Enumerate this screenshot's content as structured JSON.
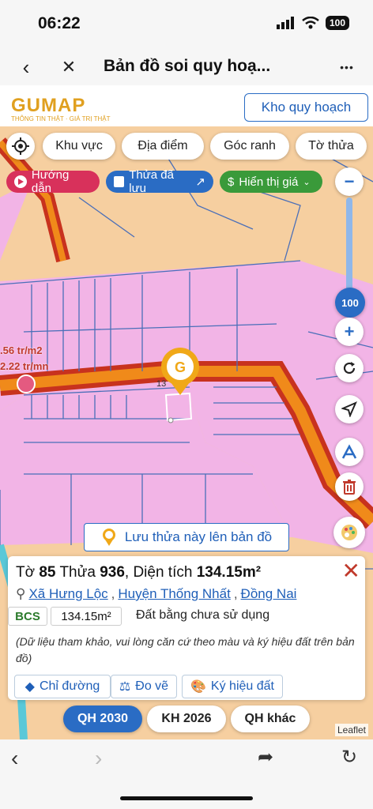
{
  "status": {
    "time": "06:22",
    "battery": "100"
  },
  "nav": {
    "title": "Bản đồ soi quy hoạ...",
    "back": "‹",
    "close": "✕",
    "more": "•••"
  },
  "header": {
    "logo": "GUMAP",
    "tagline": "THÔNG TIN THẬT · GIÁ TRỊ THẬT",
    "kho_label": "Kho quy hoạch"
  },
  "filters": {
    "khu_vuc": "Khu vực",
    "dia_diem": "Địa điểm",
    "goc_ranh": "Góc ranh",
    "to_thua": "Tờ thửa"
  },
  "pills": {
    "huong_dan": "Hướng dẫn",
    "thua_da_luu": "Thửa đã lưu",
    "hien_thi_gia": "Hiển thị giá"
  },
  "zoom": {
    "level": "100",
    "minus": "−",
    "plus": "+"
  },
  "map_labels": {
    "price1": ".56 tr/m2",
    "price2": "2.22 tr/mn",
    "parcel_no": "13"
  },
  "save_parcel": "Lưu thửa này lên bản đồ",
  "card": {
    "to_label": "Tờ",
    "to_value": "85",
    "thua_label": "Thửa",
    "thua_value": "936",
    "area_label": "Diện tích",
    "area_value": "134.15m²",
    "xa": "Xã Hưng Lộc",
    "huyen": "Huyện Thống Nhất",
    "tinh": "Đồng Nai",
    "land_code": "BCS",
    "land_area": "134.15m²",
    "land_type": "Đất bằng chưa sử dụng",
    "note": "(Dữ liệu tham khảo, vui lòng căn cứ theo màu và ký hiệu đất trên bản đồ)",
    "btn_chi_duong": "Chỉ đường",
    "btn_do_ve": "Đo vẽ",
    "btn_ky_hieu": "Ký hiệu đất"
  },
  "plans": {
    "qh2030": "QH 2030",
    "kh2026": "KH 2026",
    "qhkhac": "QH khác"
  },
  "attribution": "Leaflet",
  "colors": {
    "accent": "#2a6cc4",
    "brand": "#e0a020",
    "road": "#f08a1a",
    "pink": "#f2b4e6"
  }
}
